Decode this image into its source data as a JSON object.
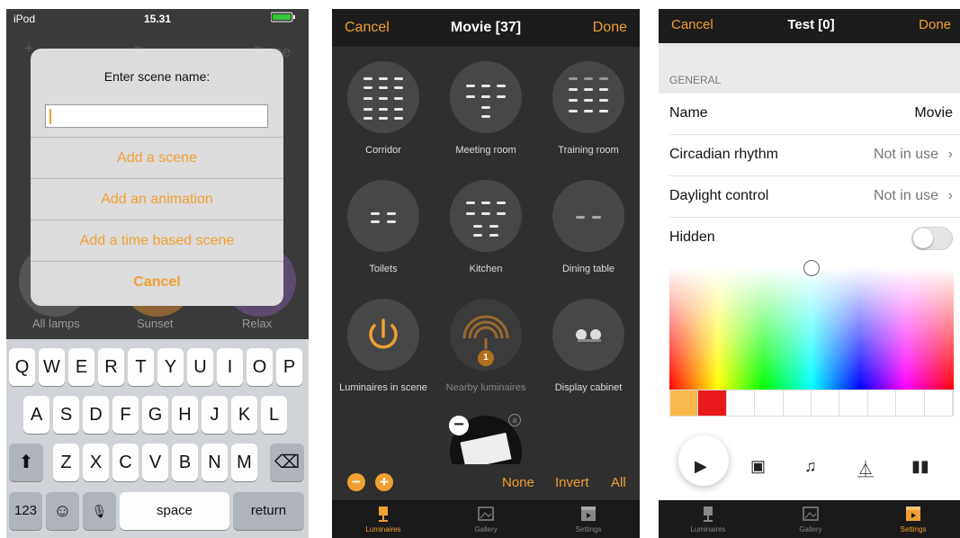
{
  "phone1": {
    "status": {
      "carrier": "iPod",
      "time": "15.31"
    },
    "background": {
      "add": "+",
      "done_left": "Done",
      "done_right": "Done",
      "scenes": [
        {
          "label": "All lamps"
        },
        {
          "label": "Sunset"
        },
        {
          "label": "Relax"
        }
      ]
    },
    "alert": {
      "title": "Enter scene name:",
      "input_value": "",
      "options": [
        "Add a scene",
        "Add an animation",
        "Add a time based scene"
      ],
      "cancel": "Cancel"
    },
    "keyboard": {
      "row1": [
        "Q",
        "W",
        "E",
        "R",
        "T",
        "Y",
        "U",
        "I",
        "O",
        "P"
      ],
      "row2": [
        "A",
        "S",
        "D",
        "F",
        "G",
        "H",
        "J",
        "K",
        "L"
      ],
      "row3": [
        "Z",
        "X",
        "C",
        "V",
        "B",
        "N",
        "M"
      ],
      "numbers": "123",
      "space": "space",
      "return": "return"
    }
  },
  "phone2": {
    "nav": {
      "cancel": "Cancel",
      "title": "Movie [37]",
      "done": "Done"
    },
    "cells": [
      {
        "label": "Corridor"
      },
      {
        "label": "Meeting room"
      },
      {
        "label": "Training room"
      },
      {
        "label": "Toilets"
      },
      {
        "label": "Kitchen"
      },
      {
        "label": "Dining table"
      },
      {
        "label": "Luminaires in scene"
      },
      {
        "label": "Nearby luminaires"
      },
      {
        "label": "Display cabinet"
      }
    ],
    "nearby_badge": "1",
    "bottom": {
      "minus": "−",
      "plus": "+",
      "none": "None",
      "invert": "Invert",
      "all": "All"
    },
    "tabs": [
      {
        "label": "Luminaires",
        "active": true
      },
      {
        "label": "Gallery"
      },
      {
        "label": "Settings"
      }
    ]
  },
  "phone3": {
    "nav": {
      "cancel": "Cancel",
      "title": "Test [0]",
      "done": "Done"
    },
    "section": "GENERAL",
    "rows": {
      "name": {
        "label": "Name",
        "value": "Movie"
      },
      "circadian": {
        "label": "Circadian rhythm",
        "value": "Not in use"
      },
      "daylight": {
        "label": "Daylight control",
        "value": "Not in use"
      },
      "hidden": {
        "label": "Hidden",
        "on": false
      }
    },
    "swatch_colors": [
      "#f9b94a",
      "#e8191a",
      "#ffffff",
      "#ffffff",
      "#ffffff",
      "#ffffff",
      "#ffffff",
      "#ffffff",
      "#ffffff",
      "#ffffff"
    ],
    "tabs": [
      {
        "label": "Luminaires"
      },
      {
        "label": "Gallery"
      },
      {
        "label": "Settings",
        "active": true
      }
    ]
  },
  "accent_color": "#f0a030"
}
